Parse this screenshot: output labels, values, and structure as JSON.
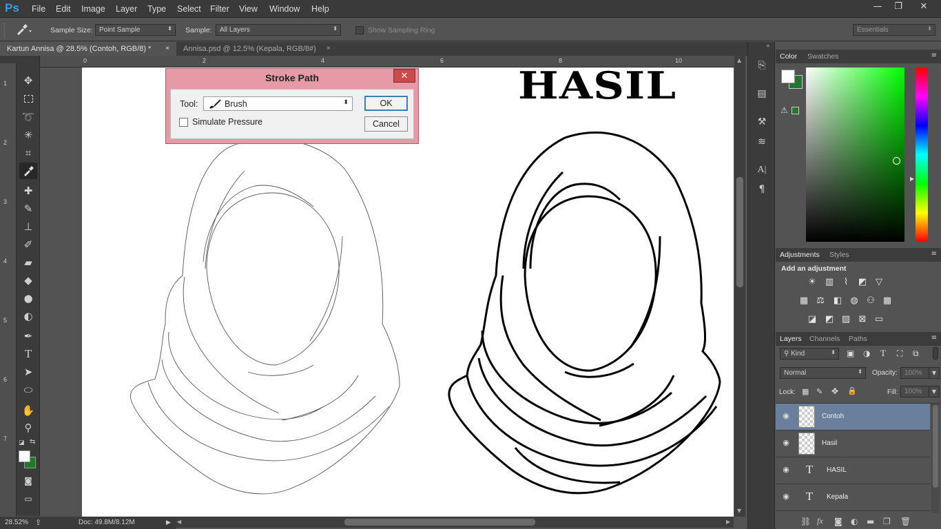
{
  "app": {
    "logo": "Ps"
  },
  "menu": [
    "File",
    "Edit",
    "Image",
    "Layer",
    "Type",
    "Select",
    "Filter",
    "View",
    "Window",
    "Help"
  ],
  "window_controls": {
    "minimize": "—",
    "restore": "❐",
    "close": "✕"
  },
  "options": {
    "sample_size_label": "Sample Size:",
    "sample_size_value": "Point Sample",
    "sample_label": "Sample:",
    "sample_value": "All Layers",
    "show_sampling_ring": "Show Sampling Ring",
    "workspace": "Essentials"
  },
  "tabs": [
    {
      "label": "Kartun Annisa @ 28.5% (Contoh, RGB/8) *",
      "close": "×"
    },
    {
      "label": "Annisa.psd @ 12.5% (Kepala, RGB/8#)",
      "close": "×"
    }
  ],
  "ruler_top": [
    "0",
    "2",
    "4",
    "6",
    "8",
    "10"
  ],
  "ruler_left": [
    "1",
    "2",
    "3",
    "4",
    "5",
    "6",
    "7"
  ],
  "canvas": {
    "hasil_text": "HASIL"
  },
  "dialog": {
    "title": "Stroke Path",
    "close": "✕",
    "tool_label": "Tool:",
    "tool_value": "Brush",
    "simulate_pressure": "Simulate Pressure",
    "ok": "OK",
    "cancel": "Cancel"
  },
  "status": {
    "zoom": "28.52%",
    "doc": "Doc: 49.8M/8.12M"
  },
  "color_panel": {
    "tabs": [
      "Color",
      "Swatches"
    ],
    "foreground": "#ffffff",
    "background": "#1e7a2a",
    "hue_color": "#00ff00"
  },
  "adjustments_panel": {
    "tabs": [
      "Adjustments",
      "Styles"
    ],
    "heading": "Add an adjustment"
  },
  "layers_panel": {
    "tabs": [
      "Layers",
      "Channels",
      "Paths"
    ],
    "kind": "Kind",
    "blend_mode": "Normal",
    "opacity_label": "Opacity:",
    "opacity_value": "100%",
    "lock_label": "Lock:",
    "fill_label": "Fill:",
    "fill_value": "100%",
    "layers": [
      {
        "name": "Contoh",
        "type": "pixel",
        "selected": true
      },
      {
        "name": "Hasil",
        "type": "pixel",
        "selected": false
      },
      {
        "name": "HASIL",
        "type": "text",
        "selected": false
      },
      {
        "name": "Kepala",
        "type": "text",
        "selected": false
      }
    ]
  }
}
